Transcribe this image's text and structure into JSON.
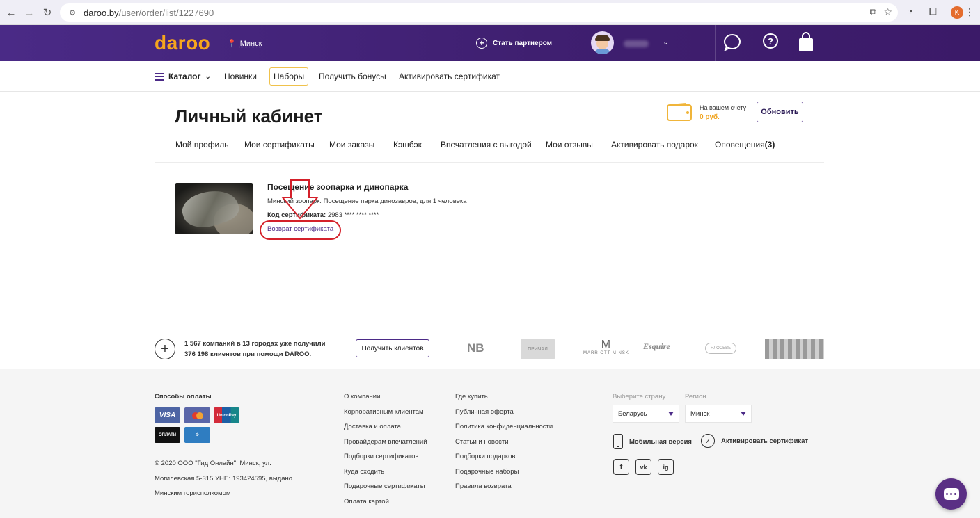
{
  "browser": {
    "url_host": "daroo.by",
    "url_path": "/user/order/list/1227690",
    "profile_initial": "K"
  },
  "header": {
    "logo": "daroo",
    "city": "Минск",
    "partner_label": "Стать партнером",
    "help_symbol": "?"
  },
  "nav": {
    "catalog": "Каталог",
    "items": [
      "Новинки",
      "Наборы",
      "Получить бонусы",
      "Активировать сертификат"
    ]
  },
  "account": {
    "title": "Личный кабинет",
    "balance_label": "На вашем счету",
    "balance_value": "0 руб.",
    "refresh_label": "Обновить",
    "tabs": [
      "Мой профиль",
      "Мои сертификаты",
      "Мои заказы",
      "Кэшбэк",
      "Впечатления с выгодой",
      "Мои отзывы",
      "Активировать подарок",
      "Оповещения"
    ],
    "notifications_count": "(3)"
  },
  "order": {
    "title": "Посещение зоопарка и динопарка",
    "description": "Минский зоопарк: Посещение парка динозавров, для 1 человека",
    "code_label": "Код сертификата:",
    "code_value": "2983 **** **** ****",
    "return_link": "Возврат сертификата"
  },
  "partners": {
    "line1": "1 567 компаний в 13 городах уже получили",
    "line2": "376 198 клиентов при помощи DAROO.",
    "button": "Получить клиентов",
    "logos": [
      "NB",
      "ПРИЧАЛ",
      "MARRIOTT MINSK",
      "Esquire",
      "ЯЛОСЕВЬ"
    ]
  },
  "footer": {
    "payment_heading": "Способы оплаты",
    "payment_methods": [
      "VISA",
      "MasterCard",
      "UnionPay",
      "ОПЛАТИ",
      "ЕРИП"
    ],
    "copyright_lines": [
      "© 2020 ООО \"Гид Онлайн\", Минск, ул.",
      "Могилевская 5-315 УНП: 193424595, выдано",
      "Минским горисполкомом"
    ],
    "col1": [
      "О компании",
      "Корпоративным клиентам",
      "Доставка и оплата",
      "Провайдерам впечатлений",
      "Подборки сертификатов",
      "Куда сходить",
      "Подарочные сертификаты",
      "Оплата картой"
    ],
    "col2": [
      "Где купить",
      "Публичная оферта",
      "Политика конфиденциальности",
      "Статьи и новости",
      "Подборки подарков",
      "Подарочные наборы",
      "Правила возврата"
    ],
    "country_label": "Выберите страну",
    "country_value": "Беларусь",
    "region_label": "Регион",
    "region_value": "Минск",
    "mobile_label": "Мобильная версия",
    "activate_label": "Активировать сертификат",
    "social": [
      "f",
      "vk",
      "ig"
    ]
  },
  "colors": {
    "brand_purple": "#4b2a87",
    "brand_orange": "#f6a51d",
    "annotation_red": "#d4202a"
  }
}
